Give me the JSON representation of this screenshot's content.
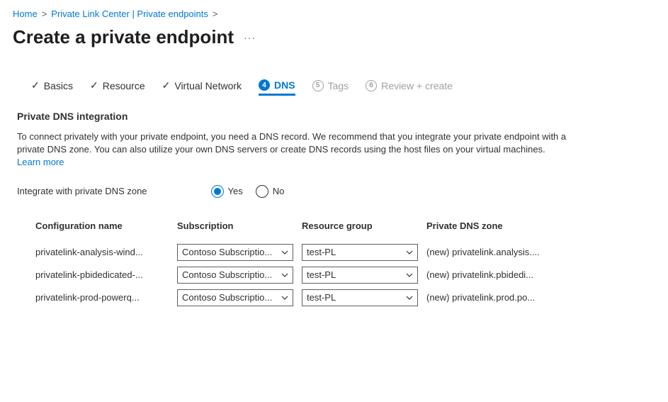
{
  "breadcrumb": {
    "home": "Home",
    "plc": "Private Link Center | Private endpoints"
  },
  "page_title": "Create a private endpoint",
  "tabs": {
    "basics": "Basics",
    "resource": "Resource",
    "vnet": "Virtual Network",
    "dns_num": "4",
    "dns": "DNS",
    "tags_num": "5",
    "tags": "Tags",
    "review_num": "6",
    "review": "Review + create"
  },
  "section": {
    "title": "Private DNS integration",
    "desc": "To connect privately with your private endpoint, you need a DNS record. We recommend that you integrate your private endpoint with a private DNS zone. You can also utilize your own DNS servers or create DNS records using the host files on your virtual machines. ",
    "learn_more": "Learn more"
  },
  "form": {
    "integrate_label": "Integrate with private DNS zone",
    "yes": "Yes",
    "no": "No"
  },
  "table": {
    "headers": {
      "config": "Configuration name",
      "sub": "Subscription",
      "rg": "Resource group",
      "dnszone": "Private DNS zone"
    },
    "rows": [
      {
        "config": "privatelink-analysis-wind...",
        "sub": "Contoso Subscriptio...",
        "rg": "test-PL",
        "dns": "(new) privatelink.analysis...."
      },
      {
        "config": "privatelink-pbidedicated-...",
        "sub": "Contoso Subscriptio...",
        "rg": "test-PL",
        "dns": "(new) privatelink.pbidedi..."
      },
      {
        "config": "privatelink-prod-powerq...",
        "sub": "Contoso Subscriptio...",
        "rg": "test-PL",
        "dns": "(new) privatelink.prod.po..."
      }
    ]
  }
}
